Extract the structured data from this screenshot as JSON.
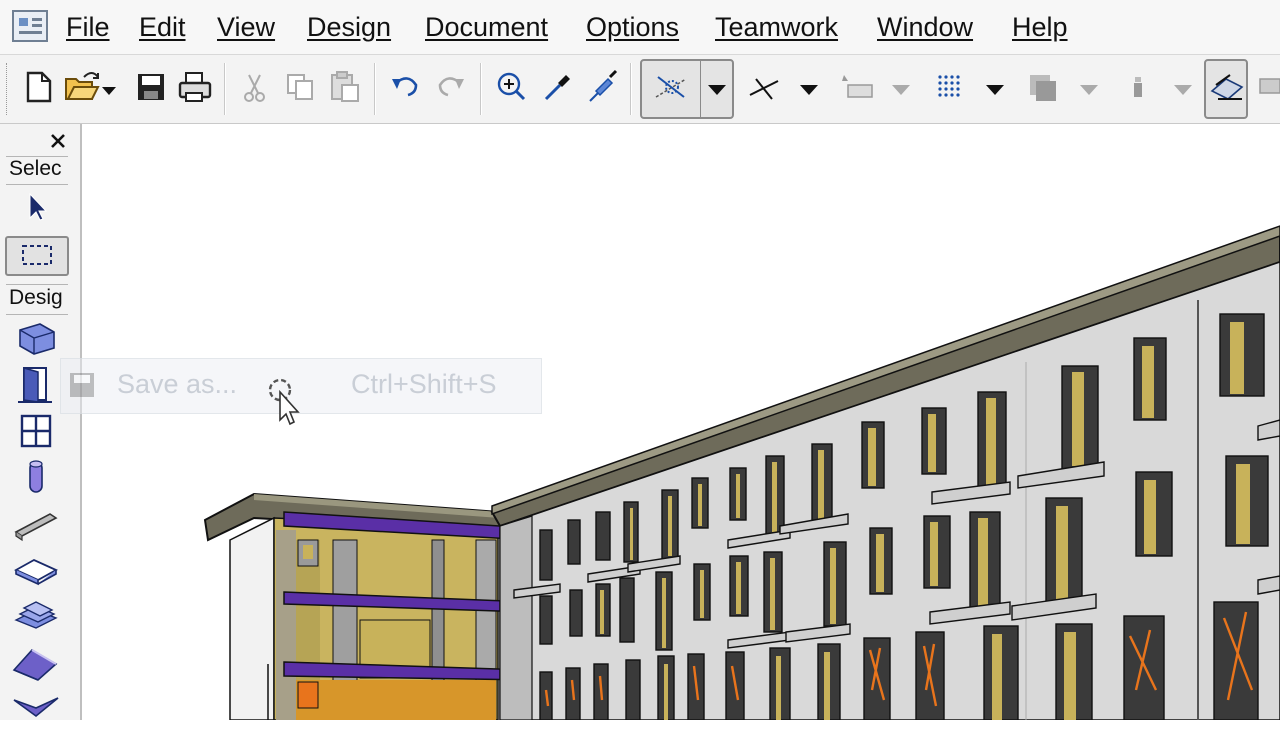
{
  "menu": [
    {
      "label": "File"
    },
    {
      "label": "Edit"
    },
    {
      "label": "View"
    },
    {
      "label": "Design"
    },
    {
      "label": "Document"
    },
    {
      "label": "Options"
    },
    {
      "label": "Teamwork"
    },
    {
      "label": "Window"
    },
    {
      "label": "Help"
    }
  ],
  "toolbar": {
    "icons": [
      "new-file-icon",
      "open-file-icon",
      "save-icon",
      "print-icon",
      "cut-icon",
      "copy-icon",
      "paste-icon",
      "undo-icon",
      "redo-icon",
      "magic-wand-icon",
      "eyedropper-icon",
      "syringe-icon",
      "trace-reference-icon",
      "guide-lines-icon",
      "gravity-icon",
      "snap-grid-icon",
      "layer-combination-icon",
      "elevation-icon",
      "section-tool-icon"
    ]
  },
  "toolbox": {
    "select_label": "Selec",
    "design_label": "Desig",
    "tools": [
      "arrow-select-icon",
      "marquee-icon",
      "wall-tool-icon",
      "door-tool-icon",
      "window-tool-icon",
      "column-tool-icon",
      "beam-tool-icon",
      "slab-tool-icon",
      "stair-tool-icon",
      "roof-tool-icon",
      "shell-tool-icon"
    ]
  },
  "ghost_menu_item": {
    "label": "Save as...",
    "shortcut": "Ctrl+Shift+S"
  },
  "colors": {
    "accent_purple": "#5a2fa6",
    "window_yellow": "#c8b25a",
    "window_orange": "#e8741c",
    "facade_grey": "#d9d9d9",
    "roof_dark": "#6f6b5c"
  }
}
